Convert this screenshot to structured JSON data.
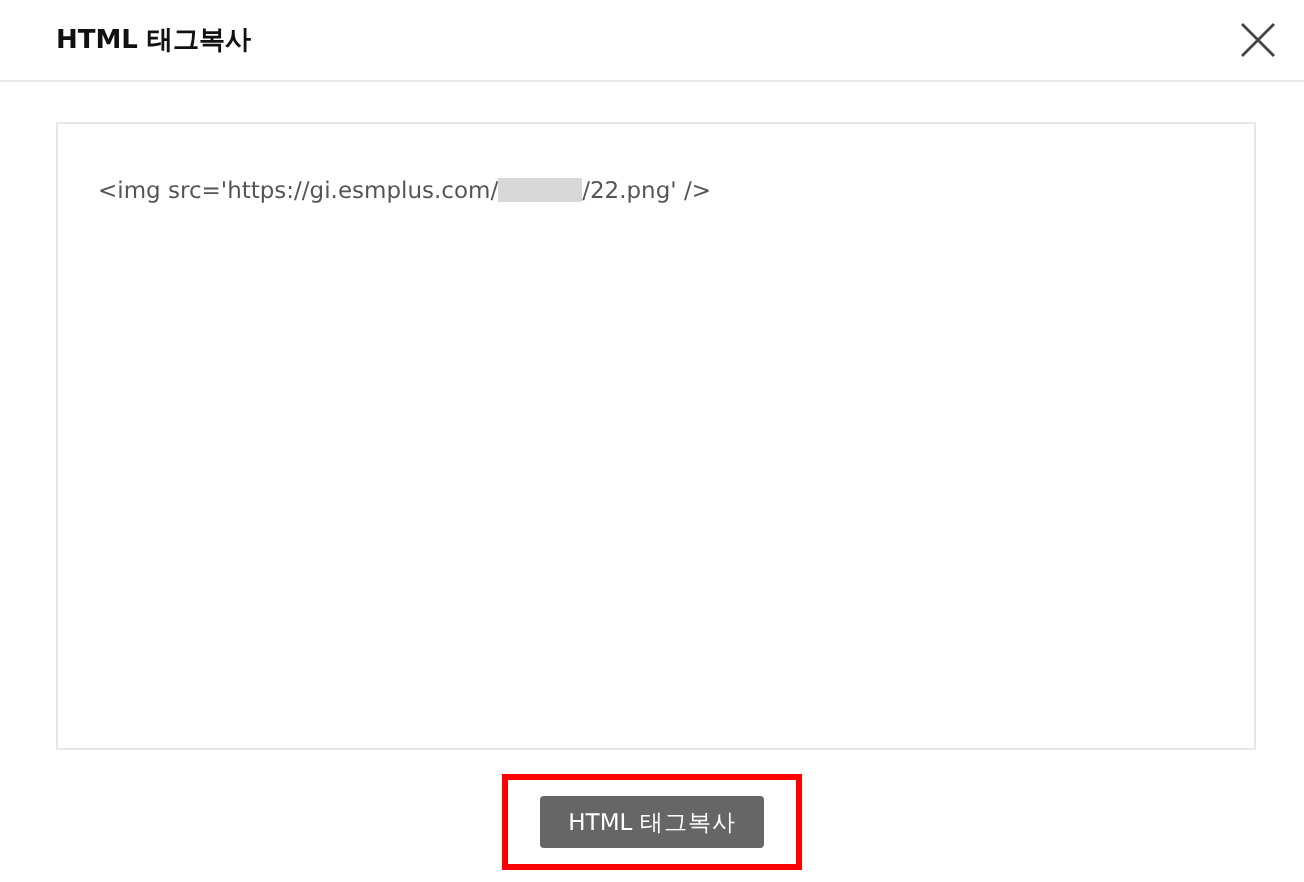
{
  "dialog": {
    "title": "HTML 태그복사"
  },
  "code_box": {
    "text_before": "<img src='https://gi.esmplus.com/",
    "text_after": "/22.png' />"
  },
  "copy_button": {
    "label": "HTML 태그복사",
    "highlighted": true
  }
}
